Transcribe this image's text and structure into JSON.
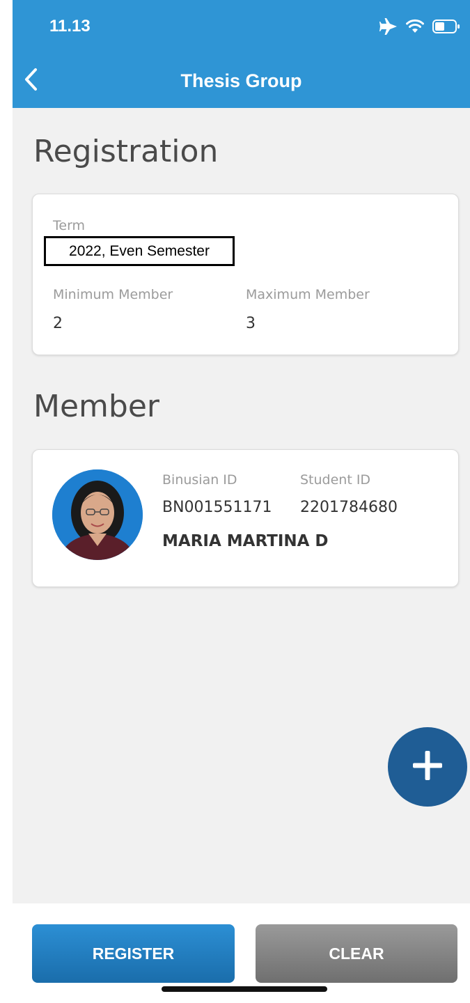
{
  "status_bar": {
    "time": "11.13",
    "icons": [
      "airplane-icon",
      "wifi-icon",
      "battery-icon"
    ]
  },
  "header": {
    "title": "Thesis Group",
    "back_icon": "chevron-left-icon"
  },
  "registration": {
    "section_title": "Registration",
    "term_label": "Term",
    "term_value": "2022, Even Semester",
    "min_member_label": "Minimum Member",
    "min_member_value": "2",
    "max_member_label": "Maximum Member",
    "max_member_value": "3"
  },
  "member": {
    "section_title": "Member",
    "members": [
      {
        "binusian_id_label": "Binusian ID",
        "binusian_id": "BN001551171",
        "student_id_label": "Student ID",
        "student_id": "2201784680",
        "name": "MARIA MARTINA D"
      }
    ]
  },
  "fab": {
    "icon": "plus-icon"
  },
  "footer": {
    "register_label": "REGISTER",
    "clear_label": "CLEAR"
  },
  "colors": {
    "header_bg": "#2f95d5",
    "page_bg": "#f1f1f1",
    "fab_bg": "#1f5d95",
    "register_bg": "#1a6dab",
    "clear_bg": "#7f7f7f"
  }
}
